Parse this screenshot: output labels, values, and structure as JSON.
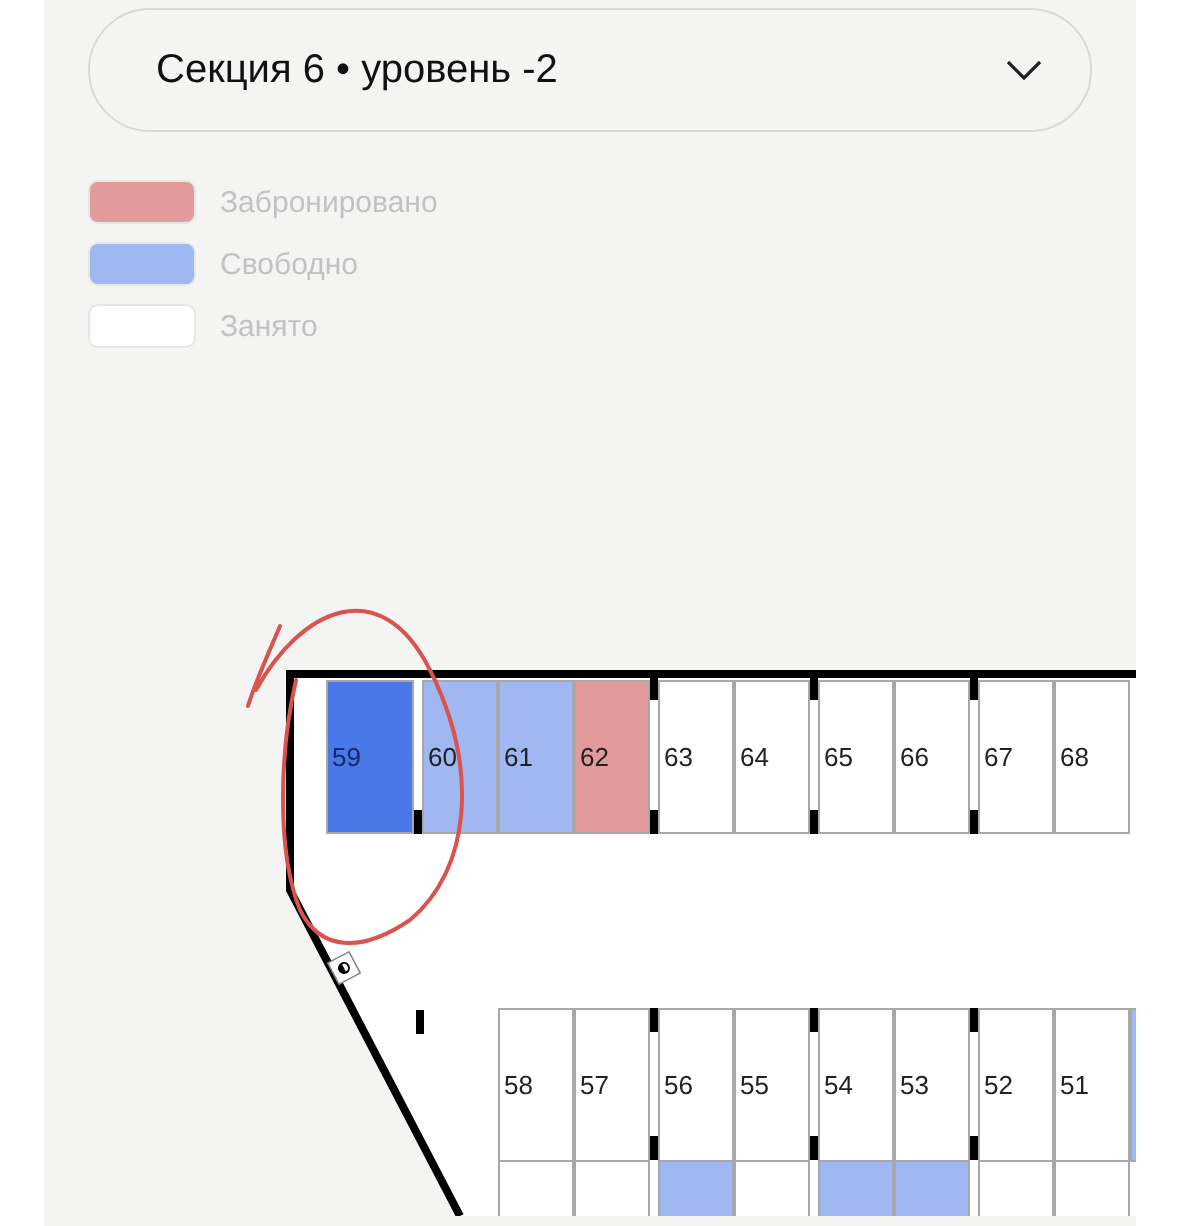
{
  "level_select": {
    "value": "Секция 6 • уровень -2"
  },
  "legend": [
    {
      "label": "Забронировано",
      "color": "#e39a9a"
    },
    {
      "label": "Свободно",
      "color": "#9fb8f2"
    },
    {
      "label": "Занято",
      "color": "#ffffff"
    }
  ],
  "top_row": [
    {
      "number": "59",
      "color": "#4a78e8",
      "selected": true
    },
    {
      "number": "60",
      "color": "#9fb8f2",
      "selected": false
    },
    {
      "number": "61",
      "color": "#9fb8f2",
      "selected": false
    },
    {
      "number": "62",
      "color": "#e39a9a",
      "selected": false
    },
    {
      "number": "63",
      "color": "#ffffff",
      "selected": false
    },
    {
      "number": "64",
      "color": "#ffffff",
      "selected": false
    },
    {
      "number": "65",
      "color": "#ffffff",
      "selected": false
    },
    {
      "number": "66",
      "color": "#ffffff",
      "selected": false
    },
    {
      "number": "67",
      "color": "#ffffff",
      "selected": false
    },
    {
      "number": "68",
      "color": "#ffffff",
      "selected": false
    }
  ],
  "bottom_row": [
    {
      "number": "58",
      "color": "#ffffff",
      "selected": false
    },
    {
      "number": "57",
      "color": "#ffffff",
      "selected": false
    },
    {
      "number": "56",
      "color": "#ffffff",
      "selected": false
    },
    {
      "number": "55",
      "color": "#ffffff",
      "selected": false
    },
    {
      "number": "54",
      "color": "#ffffff",
      "selected": false
    },
    {
      "number": "53",
      "color": "#ffffff",
      "selected": false
    },
    {
      "number": "52",
      "color": "#ffffff",
      "selected": false
    },
    {
      "number": "51",
      "color": "#ffffff",
      "selected": false
    },
    {
      "color": "#9fb8f2"
    }
  ],
  "lower_row": [
    {
      "color": "#ffffff"
    },
    {
      "color": "#ffffff"
    },
    {
      "color": "#9fb8f2"
    },
    {
      "color": "#ffffff"
    },
    {
      "color": "#9fb8f2"
    },
    {
      "color": "#9fb8f2"
    },
    {
      "color": "#ffffff"
    },
    {
      "color": "#ffffff"
    }
  ]
}
